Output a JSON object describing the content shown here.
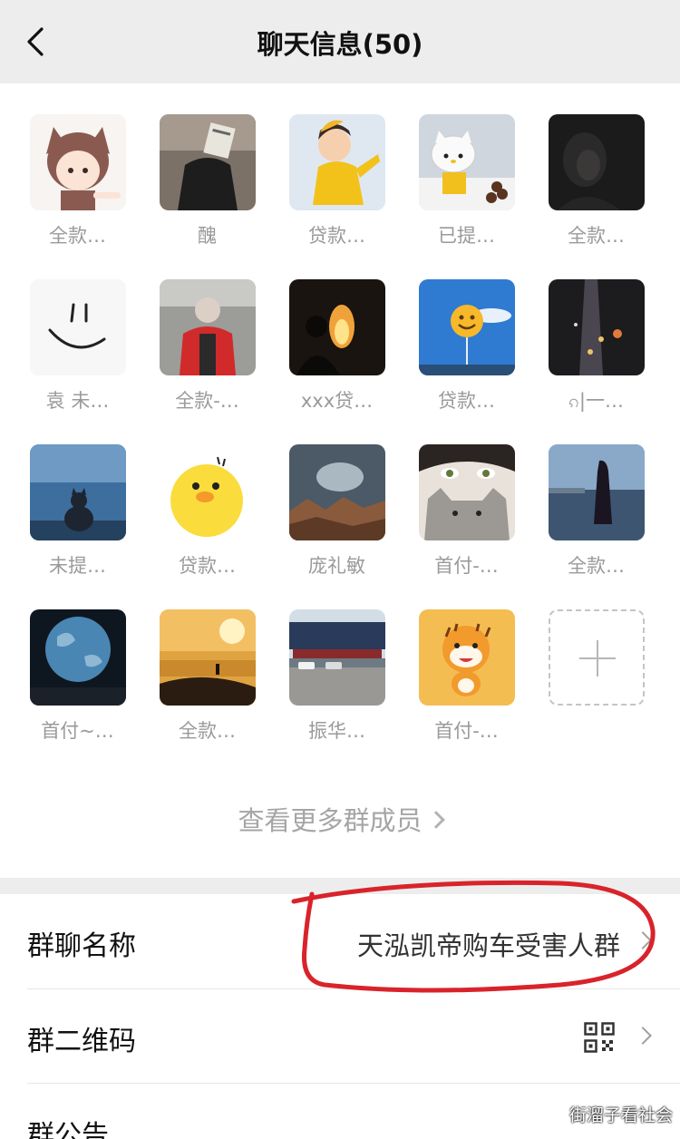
{
  "navbar": {
    "title": "聊天信息(50)",
    "back_icon": "chevron-left-icon"
  },
  "members": [
    {
      "name": "全款…",
      "avatar": "anime-cat-girl"
    },
    {
      "name": "醜",
      "avatar": "person-newspaper"
    },
    {
      "name": "贷款…",
      "avatar": "cartoon-boy-yellow"
    },
    {
      "name": "已提…",
      "avatar": "hello-kitty"
    },
    {
      "name": "全款…",
      "avatar": "dark-portrait"
    },
    {
      "name": "袁 未…",
      "avatar": "smiley-face"
    },
    {
      "name": "全款-…",
      "avatar": "person-red-jacket"
    },
    {
      "name": "xxx贷…",
      "avatar": "campfire-silhouette"
    },
    {
      "name": "贷款…",
      "avatar": "smiley-balloon-sky"
    },
    {
      "name": "ၵ|一…",
      "avatar": "night-street-lights"
    },
    {
      "name": "未提…",
      "avatar": "cat-by-sea"
    },
    {
      "name": "贷款…",
      "avatar": "yellow-duck"
    },
    {
      "name": "庞礼敏",
      "avatar": "mountain-storm"
    },
    {
      "name": "首付-…",
      "avatar": "girl-with-cat"
    },
    {
      "name": "全款…",
      "avatar": "girl-at-lake"
    },
    {
      "name": "首付~…",
      "avatar": "earth-globe"
    },
    {
      "name": "全款…",
      "avatar": "sunset-sea"
    },
    {
      "name": "振华…",
      "avatar": "car-dealership"
    },
    {
      "name": "首付-…",
      "avatar": "cartoon-tiger"
    }
  ],
  "add_member_icon": "plus-icon",
  "more_members_label": "查看更多群成员",
  "settings": {
    "group_name_label": "群聊名称",
    "group_name_value": "天泓凯帝购车受害人群",
    "qr_label": "群二维码",
    "qr_icon": "qr-code-icon",
    "notice_label": "群公告"
  },
  "watermark": "街溜子看社会",
  "colors": {
    "annotation": "#d9232b",
    "nav_bg": "#ededed",
    "muted_text": "#9a9a9a"
  }
}
